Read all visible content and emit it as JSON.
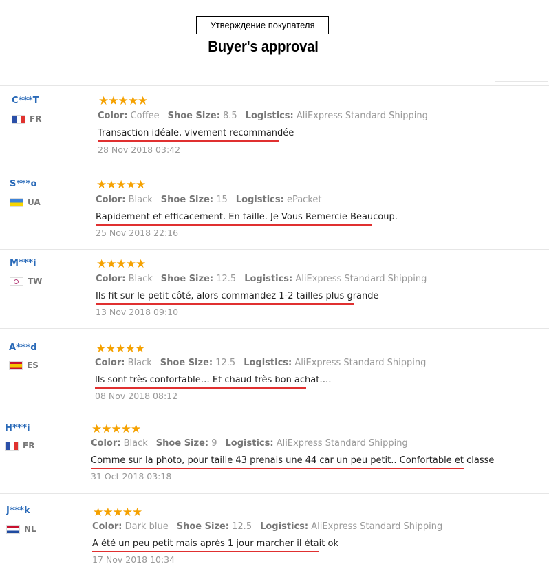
{
  "header": {
    "ru_label": "Утверждение покупателя",
    "title": "Buyer's approval"
  },
  "stars": "★★★★★",
  "labels": {
    "color": "Color:",
    "size": "Shoe Size:",
    "logistics": "Logistics:"
  },
  "reviews": [
    {
      "user": "C***T",
      "country": "FR",
      "color": "Coffee",
      "size": "8.5",
      "logistics": "AliExpress Standard Shipping",
      "comment": "Transaction idéale, vivement recommandée",
      "date": "28 Nov 2018 03:42"
    },
    {
      "user": "S***o",
      "country": "UA",
      "color": "Black",
      "size": "15",
      "logistics": "ePacket",
      "comment": "Rapidement et efficacement. En taille. Je Vous Remercie Beaucoup.",
      "date": "25 Nov 2018 22:16"
    },
    {
      "user": "M***i",
      "country": "TW",
      "color": "Black",
      "size": "12.5",
      "logistics": "AliExpress Standard Shipping",
      "comment": "Ils fit sur le petit côté, alors commandez 1-2 tailles plus grande",
      "date": "13 Nov 2018 09:10"
    },
    {
      "user": "A***d",
      "country": "ES",
      "color": "Black",
      "size": "12.5",
      "logistics": "AliExpress Standard Shipping",
      "comment": "Ils sont très confortable… Et chaud très bon achat….",
      "date": "08 Nov 2018 08:12"
    },
    {
      "user": "H***i",
      "country": "FR",
      "color": "Black",
      "size": "9",
      "logistics": "AliExpress Standard Shipping",
      "comment": "Comme sur la photo, pour taille 43 prenais une 44 car un peu petit.. Confortable et classe",
      "date": "31 Oct 2018 03:18"
    },
    {
      "user": "J***k",
      "country": "NL",
      "color": "Dark blue",
      "size": "12.5",
      "logistics": "AliExpress Standard Shipping",
      "comment": "A été un peu petit mais après 1 jour marcher il était ok",
      "date": "17 Nov 2018 10:34"
    }
  ],
  "flag_colors": {
    "FR": [
      "#2b4fa8",
      "#ffffff",
      "#e0322f"
    ],
    "UA": [
      "#3d83d8",
      "#f8d500"
    ],
    "ES": [
      "#c8102e",
      "#f5c400",
      "#c8102e"
    ],
    "NL": [
      "#c8102e",
      "#ffffff",
      "#1f4aa0"
    ],
    "TW": [
      "#ffffff",
      "#b5407a"
    ]
  }
}
